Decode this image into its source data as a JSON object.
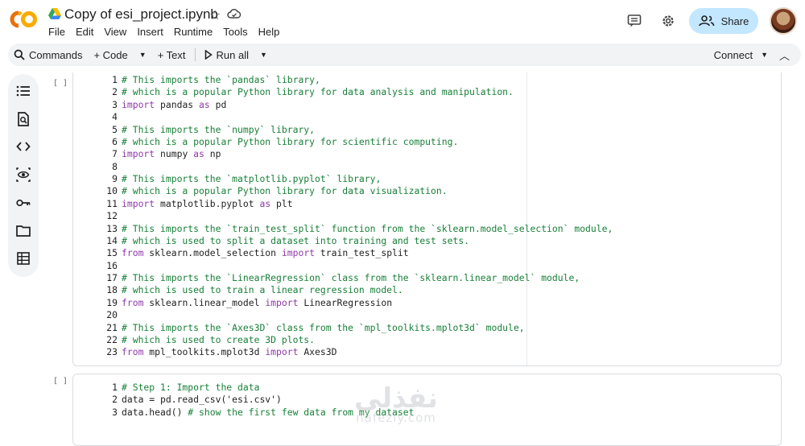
{
  "app": {
    "logo": "CO",
    "title": "Copy of esi_project.ipynb",
    "menu": [
      "File",
      "Edit",
      "View",
      "Insert",
      "Runtime",
      "Tools",
      "Help"
    ],
    "share_label": "Share"
  },
  "toolbar": {
    "commands_label": "Commands",
    "code_label": "+ Code",
    "text_label": "+ Text",
    "run_all_label": "Run all",
    "connect_label": "Connect"
  },
  "colors": {
    "accent": "#c2e7ff",
    "comment": "#188038",
    "keyword": "#8e3aa8",
    "logo_orange": "#f9ab00",
    "logo_amber": "#e8710a"
  },
  "cells": [
    {
      "bracket": "[ ]",
      "lines": [
        [
          {
            "t": "# This imports the `pandas` library,",
            "c": "cm"
          }
        ],
        [
          {
            "t": "# which is a popular Python library for data analysis and manipulation.",
            "c": "cm"
          }
        ],
        [
          {
            "t": "import",
            "c": "kw"
          },
          {
            "t": " pandas ",
            "c": "tx"
          },
          {
            "t": "as",
            "c": "kw"
          },
          {
            "t": " pd",
            "c": "tx"
          }
        ],
        [],
        [
          {
            "t": "# This imports the `numpy` library,",
            "c": "cm"
          }
        ],
        [
          {
            "t": "# which is a popular Python library for scientific computing.",
            "c": "cm"
          }
        ],
        [
          {
            "t": "import",
            "c": "kw"
          },
          {
            "t": " numpy ",
            "c": "tx"
          },
          {
            "t": "as",
            "c": "kw"
          },
          {
            "t": " np",
            "c": "tx"
          }
        ],
        [],
        [
          {
            "t": "# This imports the `matplotlib.pyplot` library,",
            "c": "cm"
          }
        ],
        [
          {
            "t": "# which is a popular Python library for data visualization.",
            "c": "cm"
          }
        ],
        [
          {
            "t": "import",
            "c": "kw"
          },
          {
            "t": " matplotlib.pyplot ",
            "c": "tx"
          },
          {
            "t": "as",
            "c": "kw"
          },
          {
            "t": " plt",
            "c": "tx"
          }
        ],
        [],
        [
          {
            "t": "# This imports the `train_test_split` function from the `sklearn.model_selection` module,",
            "c": "cm"
          }
        ],
        [
          {
            "t": "# which is used to split a dataset into training and test sets.",
            "c": "cm"
          }
        ],
        [
          {
            "t": "from",
            "c": "kw"
          },
          {
            "t": " sklearn.model_selection ",
            "c": "tx"
          },
          {
            "t": "import",
            "c": "kw"
          },
          {
            "t": " train_test_split",
            "c": "tx"
          }
        ],
        [],
        [
          {
            "t": "# This imports the `LinearRegression` class from the `sklearn.linear_model` module,",
            "c": "cm"
          }
        ],
        [
          {
            "t": "# which is used to train a linear regression model.",
            "c": "cm"
          }
        ],
        [
          {
            "t": "from",
            "c": "kw"
          },
          {
            "t": " sklearn.linear_model ",
            "c": "tx"
          },
          {
            "t": "import",
            "c": "kw"
          },
          {
            "t": " LinearRegression",
            "c": "tx"
          }
        ],
        [],
        [
          {
            "t": "# This imports the `Axes3D` class from the `mpl_toolkits.mplot3d` module,",
            "c": "cm"
          }
        ],
        [
          {
            "t": "# which is used to create 3D plots.",
            "c": "cm"
          }
        ],
        [
          {
            "t": "from",
            "c": "kw"
          },
          {
            "t": " mpl_toolkits.mplot3d ",
            "c": "tx"
          },
          {
            "t": "import",
            "c": "kw"
          },
          {
            "t": " Axes3D",
            "c": "tx"
          }
        ]
      ]
    },
    {
      "bracket": "[ ]",
      "lines": [
        [
          {
            "t": "# Step 1: Import the data",
            "c": "cm"
          }
        ],
        [
          {
            "t": "data = pd.read_csv('esi.csv')",
            "c": "tx"
          }
        ],
        [
          {
            "t": "data.head() ",
            "c": "tx"
          },
          {
            "t": "# show the first few data from my dataset",
            "c": "cm"
          }
        ]
      ]
    }
  ],
  "watermark": {
    "arabic": "نفذلي",
    "latin": "nafezly.com"
  }
}
